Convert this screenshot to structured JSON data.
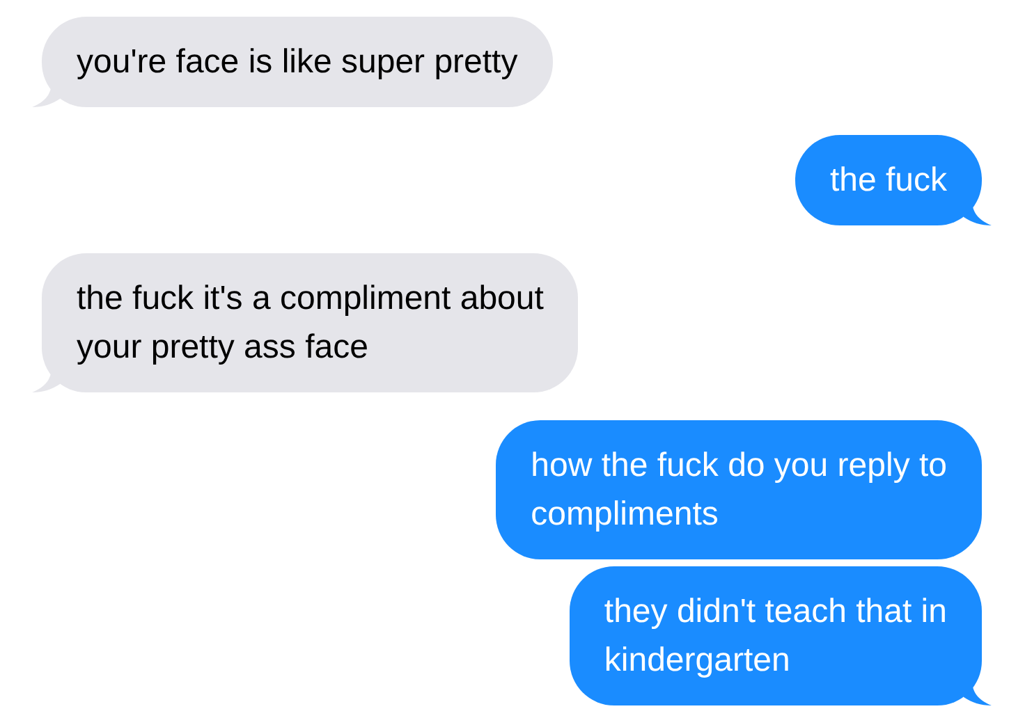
{
  "messages": [
    {
      "kind": "received",
      "tail": true,
      "lines": [
        "you're face is like super pretty"
      ]
    },
    {
      "kind": "sent",
      "tail": true,
      "lines": [
        "the fuck"
      ]
    },
    {
      "kind": "received",
      "tail": true,
      "lines": [
        "the fuck it's a compliment about",
        "your pretty ass face"
      ]
    },
    {
      "kind": "sent",
      "tail": false,
      "lines": [
        "how the fuck do you reply to",
        "compliments"
      ]
    },
    {
      "kind": "sent",
      "tail": true,
      "lines": [
        "they didn't teach that in",
        "kindergarten"
      ]
    }
  ]
}
